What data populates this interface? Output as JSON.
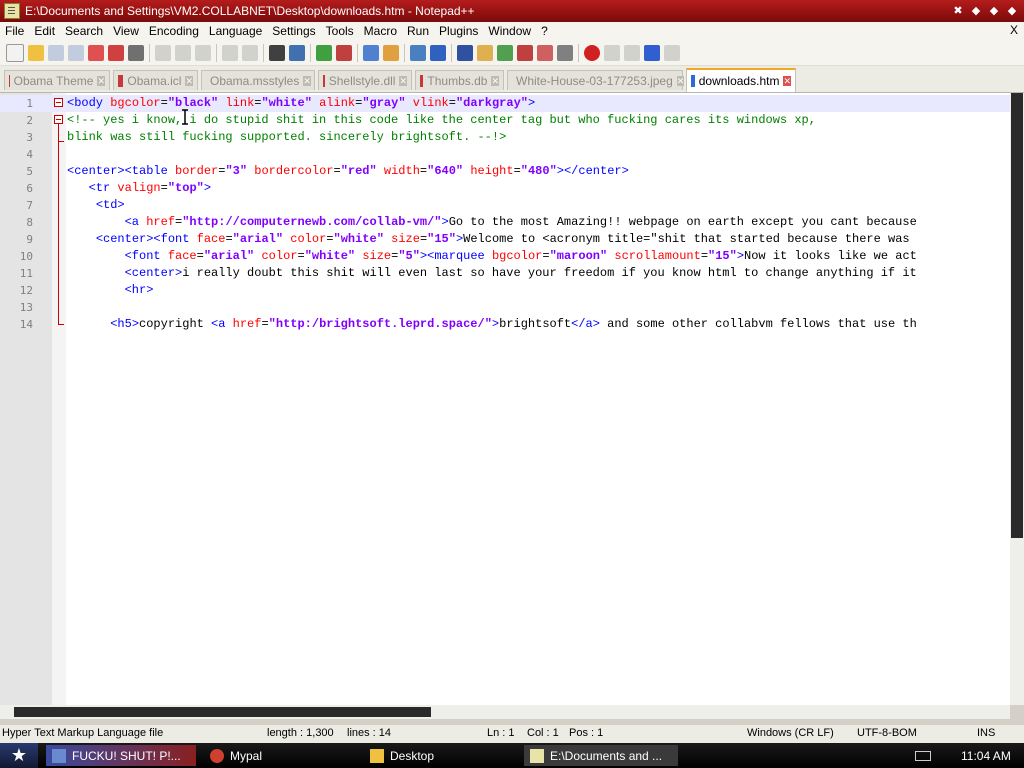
{
  "window": {
    "title": "E:\\Documents and Settings\\VM2.COLLABNET\\Desktop\\downloads.htm - Notepad++"
  },
  "menu": [
    "File",
    "Edit",
    "Search",
    "View",
    "Encoding",
    "Language",
    "Settings",
    "Tools",
    "Macro",
    "Run",
    "Plugins",
    "Window",
    "?"
  ],
  "menu_close": "X",
  "tabs": [
    {
      "label": "Obama Theme"
    },
    {
      "label": "Obama.icl"
    },
    {
      "label": "Obama.msstyles"
    },
    {
      "label": "Shellstyle.dll"
    },
    {
      "label": "Thumbs.db"
    },
    {
      "label": "White-House-03-177253.jpeg"
    },
    {
      "label": "downloads.htm"
    }
  ],
  "editor": {
    "line_numbers": [
      "1",
      "2",
      "3",
      "4",
      "5",
      "6",
      "7",
      "8",
      "9",
      "10",
      "11",
      "12",
      "13",
      "14"
    ],
    "lines": [
      "<body bgcolor=\"black\" link=\"white\" alink=\"gray\" vlink=\"darkgray\">",
      "<!-- yes i know, i do stupid shit in this code like the center tag but who fucking cares its windows xp,",
      "blink was still fucking supported. sincerely brightsoft. --!>",
      "",
      "<center><table border=\"3\" bordercolor=\"red\" width=\"640\" height=\"480\"></center>",
      "   <tr valign=\"top\">",
      "    <td>",
      "        <a href=\"http://computernewb.com/collab-vm/\">Go to the most Amazing!! webpage on earth except you cant because",
      "    <center><font face=\"arial\" color=\"white\" size=\"15\">Welcome to <acronym title=\"shit that started because there was",
      "        <font face=\"arial\" color=\"white\" size=\"5\"><marquee bgcolor=\"maroon\" scrollamount=\"15\">Now it looks like we act",
      "        <center>i really doubt this shit will even last so have your freedom if you know html to change anything if it",
      "        <hr>",
      "",
      "      <h5>copyright <a href=\"http:/brightsoft.leprd.space/\">brightsoft</a> and some other collabvm fellows that use th"
    ]
  },
  "status": {
    "file_type": "Hyper Text Markup Language file",
    "length": "length : 1,300",
    "lines": "lines : 14",
    "ln": "Ln : 1",
    "col": "Col : 1",
    "pos": "Pos : 1",
    "eol": "Windows (CR LF)",
    "encoding": "UTF-8-BOM",
    "mode": "INS"
  },
  "taskbar": {
    "items": [
      {
        "label": "FUCKU! SHUT! P!..."
      },
      {
        "label": "Mypal"
      },
      {
        "label": "Desktop"
      },
      {
        "label": "E:\\Documents and ..."
      }
    ],
    "clock": "11:04 AM"
  },
  "colors": {
    "titlebar": "#9c1414",
    "tag": "#0000ff",
    "attr": "#ff0000",
    "value": "#8000ff",
    "comment": "#008000"
  }
}
